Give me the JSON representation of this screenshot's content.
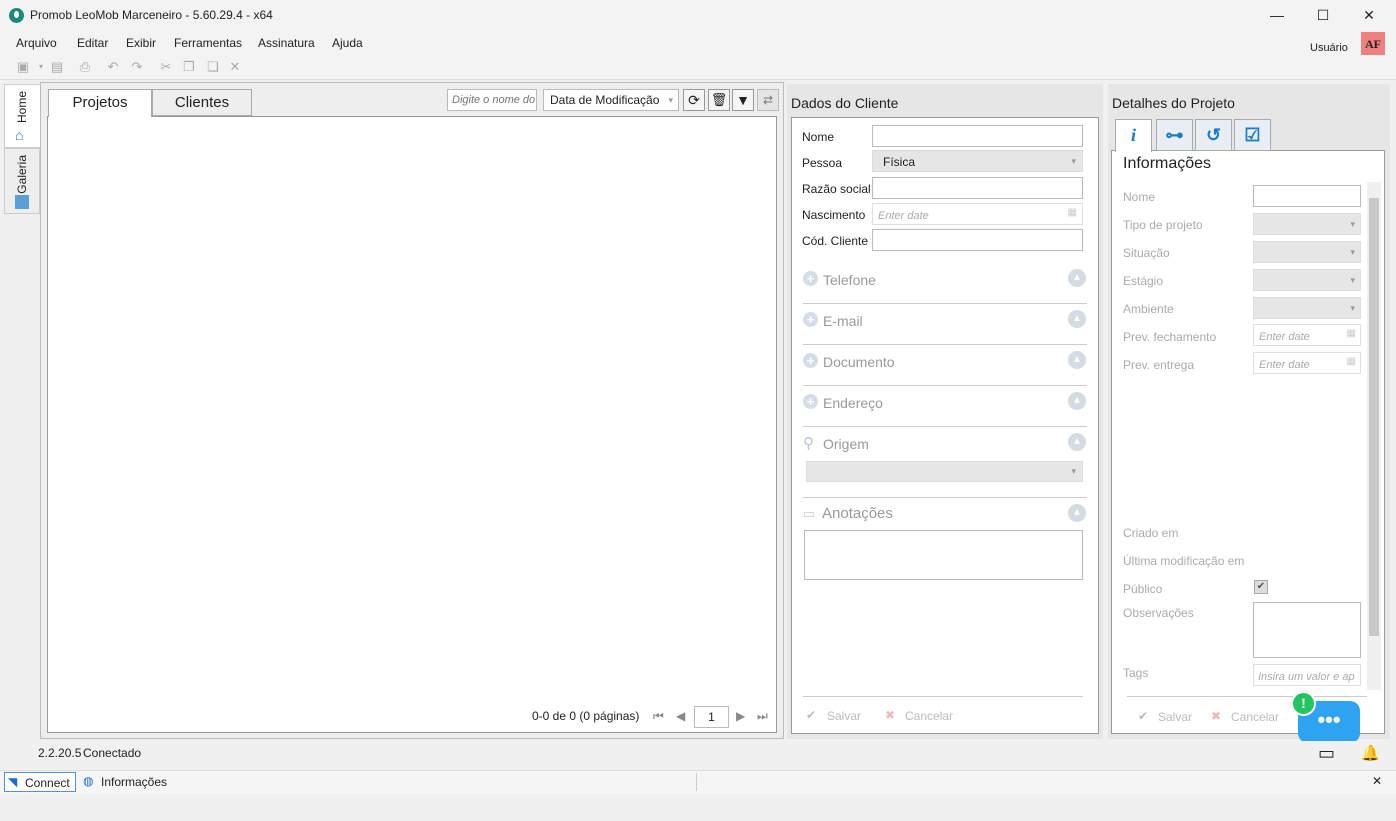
{
  "window": {
    "title": "Promob LeoMob Marceneiro - 5.60.29.4 - x64",
    "minimize": "—",
    "maximize": "☐",
    "close": "✕"
  },
  "menu": [
    "Arquivo",
    "Editar",
    "Exibir",
    "Ferramentas",
    "Assinatura",
    "Ajuda"
  ],
  "user": {
    "label": "Usuário",
    "initials": "AF",
    "avatar_color": "#f08080"
  },
  "toolbar_icons": [
    "save-icon",
    "undo-icon",
    "redo-icon",
    "cut-icon",
    "copy-icon",
    "paste-icon",
    "delete-icon"
  ],
  "side_tabs": [
    "Home",
    "Galeria"
  ],
  "projects": {
    "tabs": [
      "Projetos",
      "Clientes"
    ],
    "search_placeholder": "Digite o nome do",
    "sort_value": "Data de Modificação",
    "pagination": {
      "summary": "0-0 de 0 (0 páginas)",
      "page": "1"
    }
  },
  "client": {
    "title": "Dados do Cliente",
    "labels": {
      "nome": "Nome",
      "pessoa": "Pessoa",
      "razao": "Razão social",
      "nascimento": "Nascimento",
      "codigo": "Cód. Cliente"
    },
    "pessoa_value": "Física",
    "date_placeholder": "Enter date",
    "sections": {
      "telefone": "Telefone",
      "email": "E-mail",
      "documento": "Documento",
      "endereco": "Endereço",
      "origem": "Origem",
      "anotacoes": "Anotações"
    },
    "save": "Salvar",
    "cancel": "Cancelar"
  },
  "project": {
    "title": "Detalhes do Projeto",
    "info_title": "Informações",
    "labels": {
      "nome": "Nome",
      "tipo": "Tipo de projeto",
      "situacao": "Situação",
      "estagio": "Estágio",
      "ambiente": "Ambiente",
      "prev_fech": "Prev. fechamento",
      "prev_ent": "Prev. entrega",
      "criado": "Criado em",
      "ultima": "Última modificação em",
      "publico": "Público",
      "obs": "Observações",
      "tags": "Tags"
    },
    "date_placeholder": "Enter date",
    "tags_placeholder": "Insira um valor e ap",
    "save": "Salvar",
    "cancel": "Cancelar"
  },
  "status": {
    "version": "2.2.20.5",
    "state": "Conectado"
  },
  "bottom": {
    "connect": "Connect",
    "info": "Informações"
  },
  "chat_badge": "!"
}
